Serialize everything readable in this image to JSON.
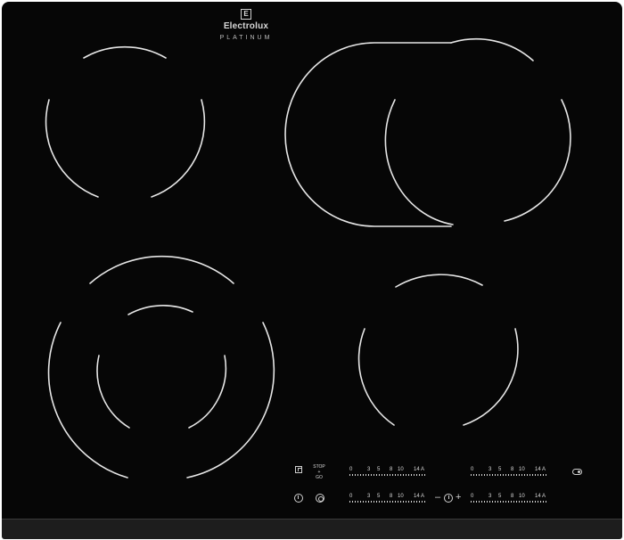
{
  "logo": {
    "brand": "Electrolux",
    "line": "PLATINUM",
    "mark": "E"
  },
  "controls": {
    "stop_go": {
      "top": "STOP",
      "mid": "+",
      "bottom": "GO"
    },
    "scales": [
      {
        "id": "scale-top-left",
        "ticks": [
          "0",
          "3",
          "5",
          "8",
          "10",
          "14 A"
        ]
      },
      {
        "id": "scale-top-right",
        "ticks": [
          "0",
          "3",
          "5",
          "8",
          "10",
          "14 A"
        ]
      },
      {
        "id": "scale-bottom-left",
        "ticks": [
          "0",
          "3",
          "5",
          "8",
          "10",
          "14 A"
        ]
      },
      {
        "id": "scale-bottom-right",
        "ticks": [
          "0",
          "3",
          "5",
          "8",
          "10",
          "14 A"
        ]
      }
    ],
    "timer": {
      "minus": "–",
      "plus": "+"
    }
  },
  "icons": {
    "lock": "lock-icon",
    "power": "power-icon",
    "zone_select": "zone-select-icon",
    "timer": "timer-icon",
    "bridge": "bridge-icon"
  },
  "colors": {
    "glass": "#060606",
    "markings": "#e6e6e6",
    "frame": "#1d1d1d"
  }
}
